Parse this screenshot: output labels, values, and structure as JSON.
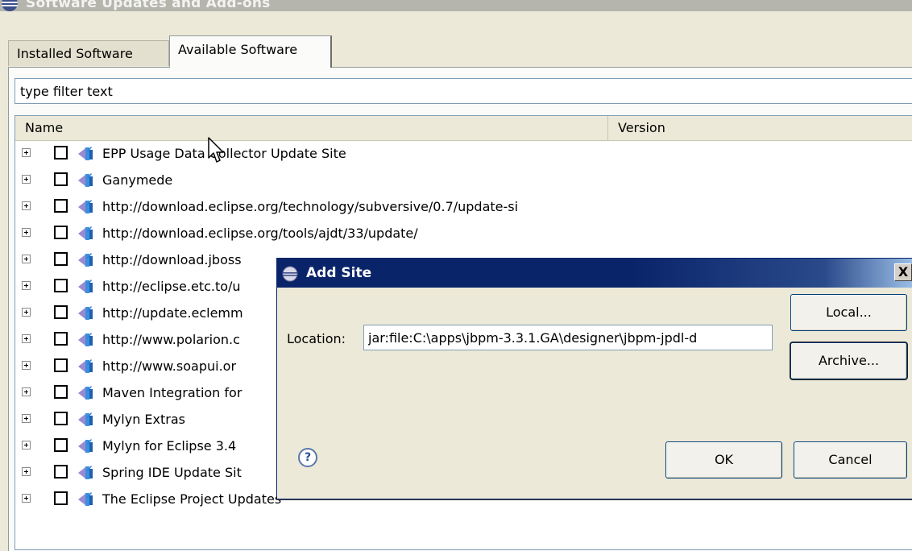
{
  "window": {
    "title": "Software Updates and Add-ons"
  },
  "tabs": [
    {
      "label": "Installed Software",
      "selected": false
    },
    {
      "label": "Available Software",
      "selected": true
    }
  ],
  "filter": {
    "value": "type filter text"
  },
  "columns": {
    "name": "Name",
    "version": "Version"
  },
  "sites": [
    "EPP Usage Data Collector Update Site",
    "Ganymede",
    "http://download.eclipse.org/technology/subversive/0.7/update-si",
    "http://download.eclipse.org/tools/ajdt/33/update/",
    "http://download.jboss",
    "http://eclipse.etc.to/u",
    "http://update.eclemm",
    "http://www.polarion.c",
    "http://www.soapui.or",
    "Maven Integration for",
    "Mylyn Extras",
    "Mylyn for Eclipse 3.4",
    "Spring IDE Update Sit",
    "The Eclipse Project Updates"
  ],
  "dialog": {
    "title": "Add Site",
    "close_label": "X",
    "location_label": "Location:",
    "location_value": "jar:file:C:\\apps\\jbpm-3.3.1.GA\\designer\\jbpm-jpdl-d",
    "local_button": "Local...",
    "archive_button": "Archive...",
    "ok_button": "OK",
    "cancel_button": "Cancel",
    "help_label": "?"
  },
  "colors": {
    "dialog_title_bg": "#0a246a",
    "window_bg": "#ece9d8",
    "site_icon_primary": "#3a8fe0",
    "site_icon_secondary": "#9a8ad0"
  },
  "icons": {
    "window": "eclipse-icon",
    "site": "update-site-icon",
    "help": "help-icon",
    "expander": "plus-expander-icon"
  }
}
